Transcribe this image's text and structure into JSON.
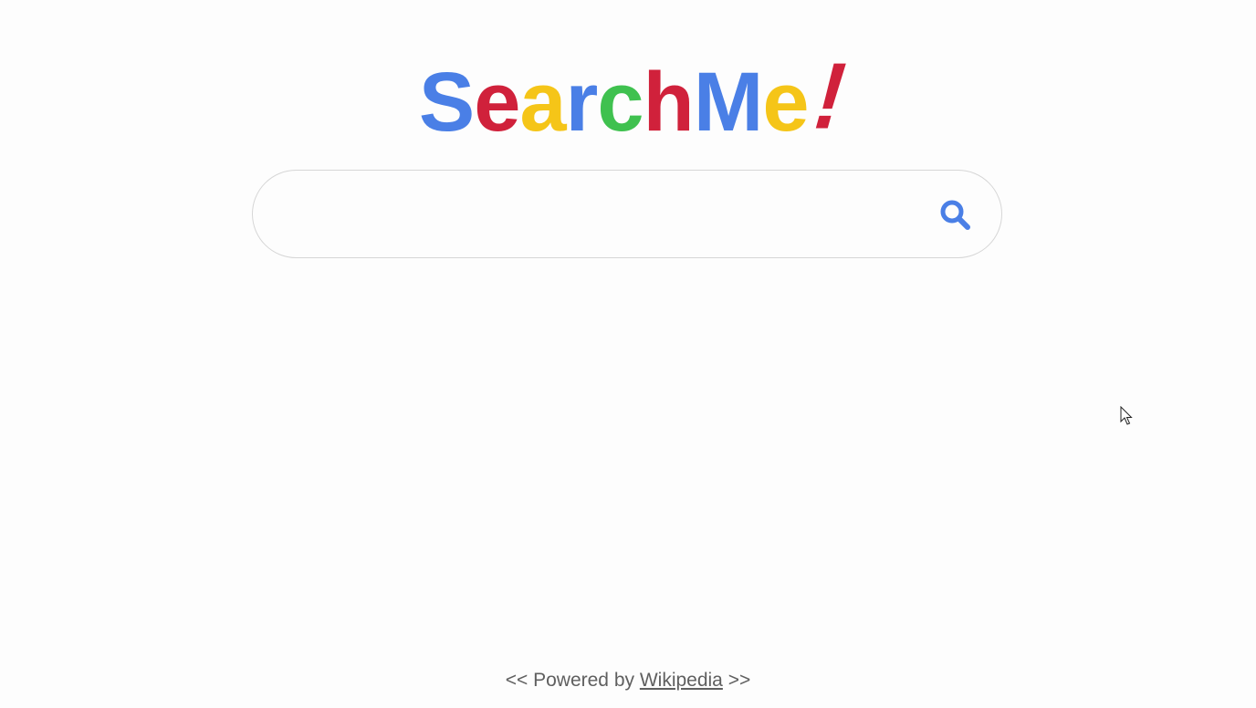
{
  "logo": {
    "letters": [
      {
        "char": "S",
        "color": "#4a7fe6"
      },
      {
        "char": "e",
        "color": "#d0213b"
      },
      {
        "char": "a",
        "color": "#f5c518"
      },
      {
        "char": "r",
        "color": "#4a7fe6"
      },
      {
        "char": "c",
        "color": "#3fc14f"
      },
      {
        "char": "h",
        "color": "#d0213b"
      },
      {
        "char": "M",
        "color": "#4a7fe6"
      },
      {
        "char": "e",
        "color": "#f5c518"
      },
      {
        "char": "!",
        "color": "#d0213b"
      }
    ]
  },
  "search": {
    "value": "",
    "placeholder": "",
    "icon": "search-icon",
    "icon_color": "#4a7fe6"
  },
  "footer": {
    "prefix": "<< Powered by ",
    "link_text": "Wikipedia",
    "suffix": " >>"
  }
}
